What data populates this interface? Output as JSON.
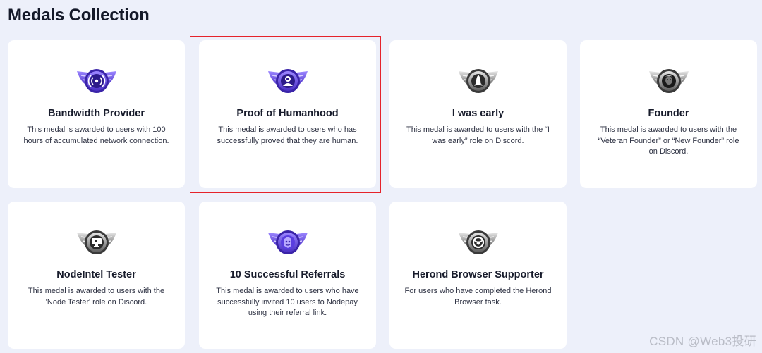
{
  "page": {
    "title": "Medals Collection"
  },
  "medals": [
    {
      "title": "Bandwidth Provider",
      "description": "This medal is awarded to users with 100 hours of accumulated network connection.",
      "icon": "signal-broadcast-icon",
      "tier": "purple"
    },
    {
      "title": "Proof of Humanhood",
      "description": "This medal is awarded to users who has successfully proved that they are human.",
      "icon": "person-avatar-icon",
      "tier": "purple"
    },
    {
      "title": "I was early",
      "description": "This medal is awarded to users with the “I was early” role on Discord.",
      "icon": "rocket-icon",
      "tier": "silver"
    },
    {
      "title": "Founder",
      "description": "This medal is awarded to users with the “Veteran Founder” or “New Founder” role on Discord.",
      "icon": "founder-portrait-icon",
      "tier": "silver"
    },
    {
      "title": "NodeIntel Tester",
      "description": "This medal is awarded to users with the 'Node Tester' role on Discord.",
      "icon": "monitor-icon",
      "tier": "silver"
    },
    {
      "title": "10 Successful Referrals",
      "description": "This medal is awarded to users who have successfully invited 10 users to Nodepay using their referral link.",
      "icon": "referral-badge-icon",
      "tier": "purple"
    },
    {
      "title": "Herond Browser Supporter",
      "description": "For users who have completed the Herond Browser task.",
      "icon": "herond-browser-icon",
      "tier": "silver"
    }
  ],
  "watermark": "CSDN @Web3投研",
  "colors": {
    "purple_medal": "#6b4fe0",
    "silver_medal": "#5a5a5a",
    "highlight": "#e5232b",
    "background": "#edf0fa"
  }
}
